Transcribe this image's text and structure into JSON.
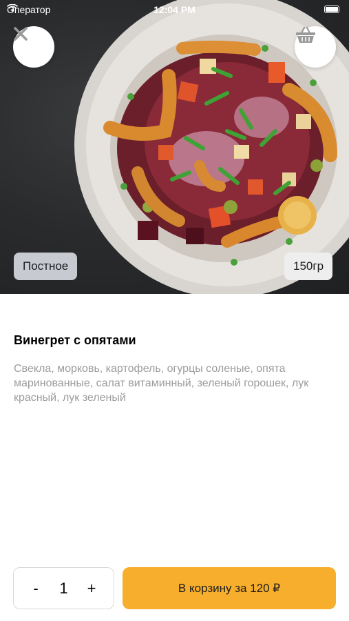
{
  "status_bar": {
    "carrier": "Оператор",
    "time": "12:04 PM"
  },
  "hero": {
    "tag": "Постное",
    "weight": "150гр"
  },
  "product": {
    "title": "Винегрет с опятами",
    "description": "Свекла, морковь, картофель, огурцы соленые, опята маринованные, салат витаминный, зеленый горошек, лук красный, лук зеленый"
  },
  "order": {
    "decrement_label": "-",
    "quantity": "1",
    "increment_label": "+",
    "cart_button_label": "В корзину за 120 ₽"
  },
  "icons": {
    "close": "close-icon",
    "basket": "basket-icon",
    "wifi": "wifi-icon",
    "battery": "battery-icon"
  },
  "colors": {
    "accent": "#f7ae2c",
    "tag_bg": "#c8cad2",
    "description": "#9b9b9b"
  }
}
